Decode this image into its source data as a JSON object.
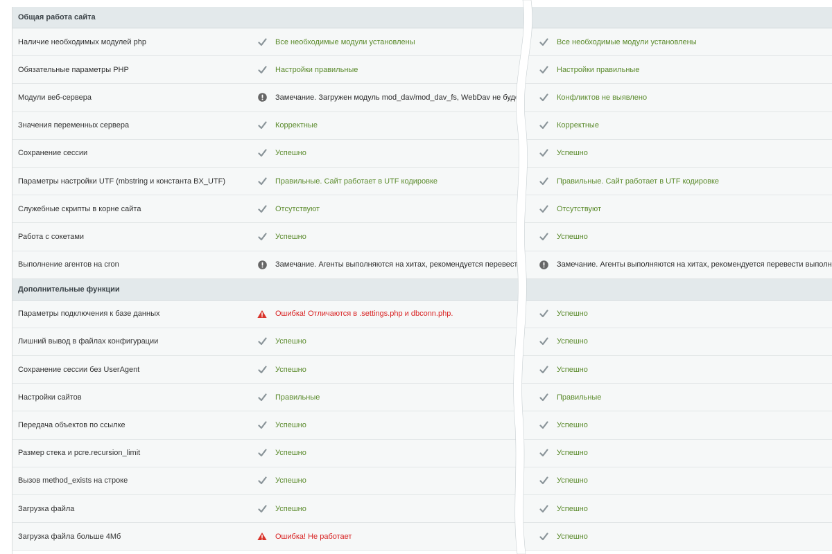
{
  "sections": [
    {
      "title": "Общая работа сайта",
      "rows": [
        {
          "name": "Наличие необходимых модулей php",
          "left": {
            "status": "ok",
            "text": "Все необходимые модули установлены"
          },
          "right": {
            "status": "ok",
            "text": "Все необходимые модули установлены"
          }
        },
        {
          "name": "Обязательные параметры PHP",
          "left": {
            "status": "ok",
            "text": "Настройки правильные"
          },
          "right": {
            "status": "ok",
            "text": "Настройки правильные"
          }
        },
        {
          "name": "Модули веб-сервера",
          "left": {
            "status": "warn",
            "text": "Замечание. Загружен модуль mod_dav/mod_dav_fs, WebDav не будет раб"
          },
          "right": {
            "status": "ok",
            "text": "Конфликтов не выявлено"
          }
        },
        {
          "name": "Значения переменных сервера",
          "left": {
            "status": "ok",
            "text": "Корректные"
          },
          "right": {
            "status": "ok",
            "text": "Корректные"
          }
        },
        {
          "name": "Сохранение сессии",
          "left": {
            "status": "ok",
            "text": "Успешно"
          },
          "right": {
            "status": "ok",
            "text": "Успешно"
          }
        },
        {
          "name": "Параметры настройки UTF (mbstring и константа BX_UTF)",
          "left": {
            "status": "ok",
            "text": "Правильные. Сайт работает в UTF кодировке"
          },
          "right": {
            "status": "ok",
            "text": "Правильные. Сайт работает в UTF кодировке"
          }
        },
        {
          "name": "Служебные скрипты в корне сайта",
          "left": {
            "status": "ok",
            "text": "Отсутствуют"
          },
          "right": {
            "status": "ok",
            "text": "Отсутствуют"
          }
        },
        {
          "name": "Работа с сокетами",
          "left": {
            "status": "ok",
            "text": "Успешно"
          },
          "right": {
            "status": "ok",
            "text": "Успешно"
          }
        },
        {
          "name": "Выполнение агентов на cron",
          "left": {
            "status": "warn",
            "text": "Замечание. Агенты выполняются на хитах, рекомендуется перевести выпол"
          },
          "right": {
            "status": "warn",
            "text": "Замечание. Агенты выполняются на хитах, рекомендуется перевести выполнение"
          }
        }
      ]
    },
    {
      "title": "Дополнительные функции",
      "rows": [
        {
          "name": "Параметры подключения к базе данных",
          "left": {
            "status": "err",
            "text": "Ошибка! Отличаются в .settings.php и dbconn.php."
          },
          "right": {
            "status": "ok",
            "text": "Успешно"
          }
        },
        {
          "name": "Лишний вывод в файлах конфигурации",
          "left": {
            "status": "ok",
            "text": "Успешно"
          },
          "right": {
            "status": "ok",
            "text": "Успешно"
          }
        },
        {
          "name": "Сохранение сессии без UserAgent",
          "left": {
            "status": "ok",
            "text": "Успешно"
          },
          "right": {
            "status": "ok",
            "text": "Успешно"
          }
        },
        {
          "name": "Настройки сайтов",
          "left": {
            "status": "ok",
            "text": "Правильные"
          },
          "right": {
            "status": "ok",
            "text": "Правильные"
          }
        },
        {
          "name": "Передача объектов по ссылке",
          "left": {
            "status": "ok",
            "text": "Успешно"
          },
          "right": {
            "status": "ok",
            "text": "Успешно"
          }
        },
        {
          "name": "Размер стека и pcre.recursion_limit",
          "left": {
            "status": "ok",
            "text": "Успешно"
          },
          "right": {
            "status": "ok",
            "text": "Успешно"
          }
        },
        {
          "name": "Вызов method_exists на строке",
          "left": {
            "status": "ok",
            "text": "Успешно"
          },
          "right": {
            "status": "ok",
            "text": "Успешно"
          }
        },
        {
          "name": "Загрузка файла",
          "left": {
            "status": "ok",
            "text": "Успешно"
          },
          "right": {
            "status": "ok",
            "text": "Успешно"
          }
        },
        {
          "name": "Загрузка файла больше 4Мб",
          "left": {
            "status": "err",
            "text": "Ошибка! Не работает"
          },
          "right": {
            "status": "ok",
            "text": "Успешно"
          }
        }
      ]
    }
  ],
  "icons": {
    "ok": "checkmark-icon",
    "warn": "info-circle-icon",
    "err": "warning-triangle-icon"
  },
  "colors": {
    "ok_text": "#5a8a2b",
    "error_text": "#d81f1f",
    "warning_icon": "#666666",
    "error_icon": "#d9342b",
    "check_icon": "#8a9499"
  }
}
